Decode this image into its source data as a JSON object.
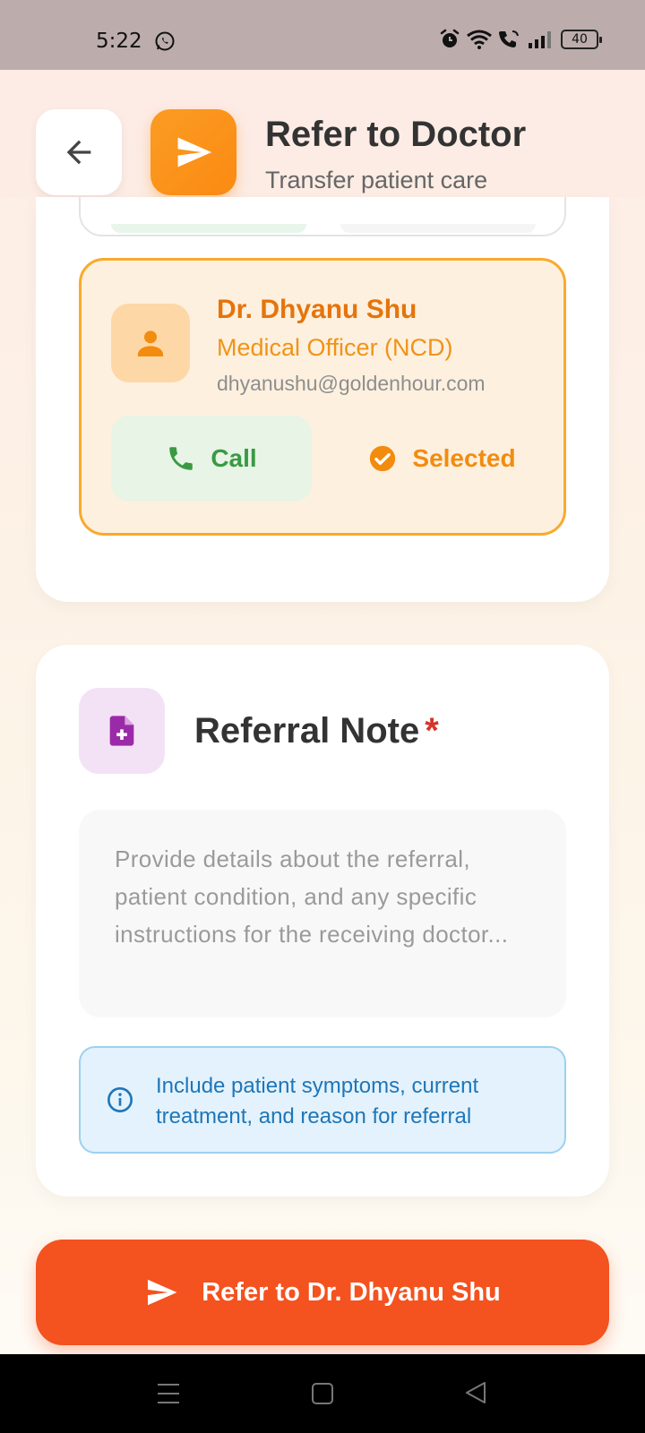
{
  "status_bar": {
    "time": "5:22",
    "battery": "40",
    "icons": [
      "whatsapp-icon",
      "alarm-icon",
      "wifi-icon",
      "volte-call-icon",
      "signal-icon",
      "battery-icon"
    ]
  },
  "header": {
    "title": "Refer to Doctor",
    "subtitle": "Transfer patient care",
    "back_icon": "arrow-left-icon",
    "header_icon": "send-icon",
    "accent_color": "#fb8f16"
  },
  "doctor": {
    "name": "Dr. Dhyanu Shu",
    "role": "Medical Officer (NCD)",
    "email": "dhyanushu@goldenhour.com",
    "call_label": "Call",
    "selected_label": "Selected",
    "avatar_icon": "person-icon",
    "selected_color": "#f28c0f"
  },
  "referral_note": {
    "title": "Referral Note",
    "required_mark": "*",
    "icon": "note-add-icon",
    "value": "",
    "placeholder": "Provide details about the referral, patient condition, and any specific instructions for the receiving doctor...",
    "info_text": "Include patient symptoms, current treatment, and reason for referral"
  },
  "submit": {
    "label": "Refer to Dr. Dhyanu Shu",
    "color": "#f4521f"
  },
  "nav_bar": {
    "icons": [
      "menu-icon",
      "home-square-icon",
      "back-triangle-icon"
    ]
  }
}
